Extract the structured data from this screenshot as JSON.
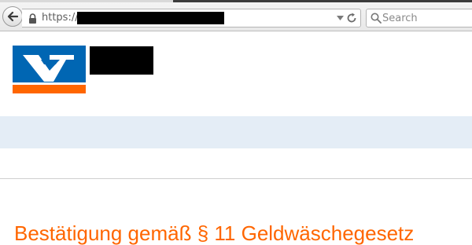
{
  "browser": {
    "url_prefix": "https://",
    "url_redacted": true,
    "search_placeholder": "Search",
    "icons": {
      "back": "back-arrow-icon",
      "lock": "lock-icon",
      "dropdown": "dropdown-arrow-icon",
      "reload": "reload-icon",
      "search": "magnifier-icon"
    }
  },
  "site": {
    "logo": "volksbank-v-logo",
    "name_redacted": true
  },
  "main": {
    "title": "Bestätigung gemäß § 11 Geldwäschegesetz"
  },
  "colors": {
    "brand_blue": "#0066b3",
    "brand_orange": "#ff6600",
    "nav_band": "#e4edf6",
    "title": "#ff6600"
  }
}
